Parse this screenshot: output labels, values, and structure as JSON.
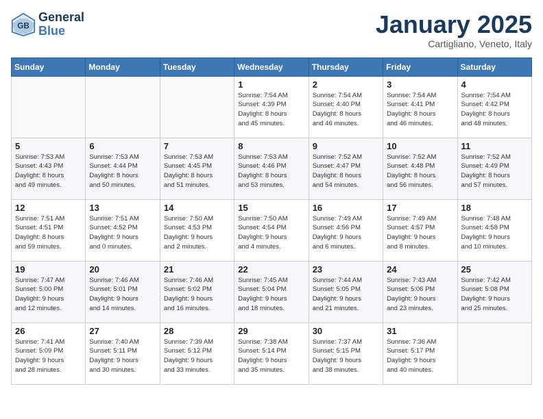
{
  "header": {
    "logo_line1": "General",
    "logo_line2": "Blue",
    "month": "January 2025",
    "location": "Cartigliano, Veneto, Italy"
  },
  "weekdays": [
    "Sunday",
    "Monday",
    "Tuesday",
    "Wednesday",
    "Thursday",
    "Friday",
    "Saturday"
  ],
  "weeks": [
    [
      {
        "day": "",
        "info": ""
      },
      {
        "day": "",
        "info": ""
      },
      {
        "day": "",
        "info": ""
      },
      {
        "day": "1",
        "info": "Sunrise: 7:54 AM\nSunset: 4:39 PM\nDaylight: 8 hours\nand 45 minutes."
      },
      {
        "day": "2",
        "info": "Sunrise: 7:54 AM\nSunset: 4:40 PM\nDaylight: 8 hours\nand 46 minutes."
      },
      {
        "day": "3",
        "info": "Sunrise: 7:54 AM\nSunset: 4:41 PM\nDaylight: 8 hours\nand 46 minutes."
      },
      {
        "day": "4",
        "info": "Sunrise: 7:54 AM\nSunset: 4:42 PM\nDaylight: 8 hours\nand 48 minutes."
      }
    ],
    [
      {
        "day": "5",
        "info": "Sunrise: 7:53 AM\nSunset: 4:43 PM\nDaylight: 8 hours\nand 49 minutes."
      },
      {
        "day": "6",
        "info": "Sunrise: 7:53 AM\nSunset: 4:44 PM\nDaylight: 8 hours\nand 50 minutes."
      },
      {
        "day": "7",
        "info": "Sunrise: 7:53 AM\nSunset: 4:45 PM\nDaylight: 8 hours\nand 51 minutes."
      },
      {
        "day": "8",
        "info": "Sunrise: 7:53 AM\nSunset: 4:46 PM\nDaylight: 8 hours\nand 53 minutes."
      },
      {
        "day": "9",
        "info": "Sunrise: 7:52 AM\nSunset: 4:47 PM\nDaylight: 8 hours\nand 54 minutes."
      },
      {
        "day": "10",
        "info": "Sunrise: 7:52 AM\nSunset: 4:48 PM\nDaylight: 8 hours\nand 56 minutes."
      },
      {
        "day": "11",
        "info": "Sunrise: 7:52 AM\nSunset: 4:49 PM\nDaylight: 8 hours\nand 57 minutes."
      }
    ],
    [
      {
        "day": "12",
        "info": "Sunrise: 7:51 AM\nSunset: 4:51 PM\nDaylight: 8 hours\nand 59 minutes."
      },
      {
        "day": "13",
        "info": "Sunrise: 7:51 AM\nSunset: 4:52 PM\nDaylight: 9 hours\nand 0 minutes."
      },
      {
        "day": "14",
        "info": "Sunrise: 7:50 AM\nSunset: 4:53 PM\nDaylight: 9 hours\nand 2 minutes."
      },
      {
        "day": "15",
        "info": "Sunrise: 7:50 AM\nSunset: 4:54 PM\nDaylight: 9 hours\nand 4 minutes."
      },
      {
        "day": "16",
        "info": "Sunrise: 7:49 AM\nSunset: 4:56 PM\nDaylight: 9 hours\nand 6 minutes."
      },
      {
        "day": "17",
        "info": "Sunrise: 7:49 AM\nSunset: 4:57 PM\nDaylight: 9 hours\nand 8 minutes."
      },
      {
        "day": "18",
        "info": "Sunrise: 7:48 AM\nSunset: 4:58 PM\nDaylight: 9 hours\nand 10 minutes."
      }
    ],
    [
      {
        "day": "19",
        "info": "Sunrise: 7:47 AM\nSunset: 5:00 PM\nDaylight: 9 hours\nand 12 minutes."
      },
      {
        "day": "20",
        "info": "Sunrise: 7:46 AM\nSunset: 5:01 PM\nDaylight: 9 hours\nand 14 minutes."
      },
      {
        "day": "21",
        "info": "Sunrise: 7:46 AM\nSunset: 5:02 PM\nDaylight: 9 hours\nand 16 minutes."
      },
      {
        "day": "22",
        "info": "Sunrise: 7:45 AM\nSunset: 5:04 PM\nDaylight: 9 hours\nand 18 minutes."
      },
      {
        "day": "23",
        "info": "Sunrise: 7:44 AM\nSunset: 5:05 PM\nDaylight: 9 hours\nand 21 minutes."
      },
      {
        "day": "24",
        "info": "Sunrise: 7:43 AM\nSunset: 5:06 PM\nDaylight: 9 hours\nand 23 minutes."
      },
      {
        "day": "25",
        "info": "Sunrise: 7:42 AM\nSunset: 5:08 PM\nDaylight: 9 hours\nand 25 minutes."
      }
    ],
    [
      {
        "day": "26",
        "info": "Sunrise: 7:41 AM\nSunset: 5:09 PM\nDaylight: 9 hours\nand 28 minutes."
      },
      {
        "day": "27",
        "info": "Sunrise: 7:40 AM\nSunset: 5:11 PM\nDaylight: 9 hours\nand 30 minutes."
      },
      {
        "day": "28",
        "info": "Sunrise: 7:39 AM\nSunset: 5:12 PM\nDaylight: 9 hours\nand 33 minutes."
      },
      {
        "day": "29",
        "info": "Sunrise: 7:38 AM\nSunset: 5:14 PM\nDaylight: 9 hours\nand 35 minutes."
      },
      {
        "day": "30",
        "info": "Sunrise: 7:37 AM\nSunset: 5:15 PM\nDaylight: 9 hours\nand 38 minutes."
      },
      {
        "day": "31",
        "info": "Sunrise: 7:36 AM\nSunset: 5:17 PM\nDaylight: 9 hours\nand 40 minutes."
      },
      {
        "day": "",
        "info": ""
      }
    ]
  ]
}
